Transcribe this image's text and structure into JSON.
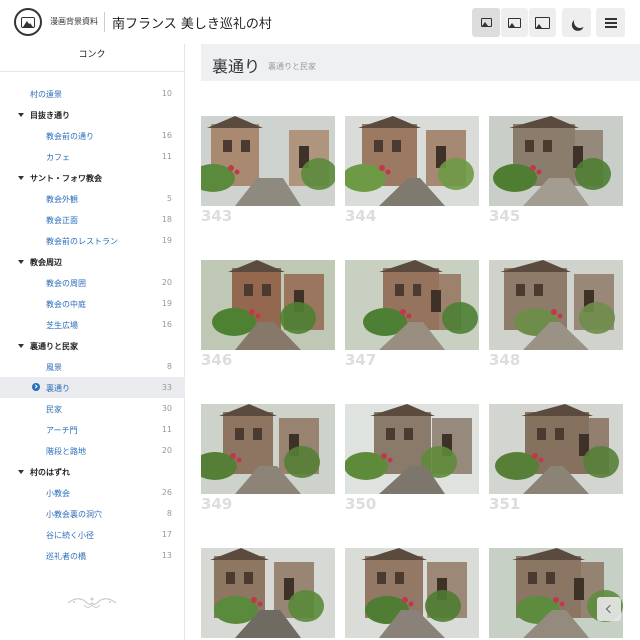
{
  "header": {
    "site_name": "漫画背景資料",
    "page_title": "南フランス 美しき巡礼の村",
    "buttons": [
      {
        "icon": "image-small-icon",
        "active": true
      },
      {
        "icon": "image-medium-icon",
        "active": false
      },
      {
        "icon": "image-large-icon",
        "active": false
      },
      {
        "icon": "moon-icon",
        "active": false
      },
      {
        "icon": "menu-icon",
        "active": false
      }
    ]
  },
  "sidebar": {
    "title": "コンク",
    "rows": [
      {
        "kind": "top",
        "label": "村の遠景",
        "count": "10"
      },
      {
        "kind": "group",
        "label": "目抜き通り"
      },
      {
        "kind": "child",
        "label": "教会前の通り",
        "count": "16"
      },
      {
        "kind": "child",
        "label": "カフェ",
        "count": "11"
      },
      {
        "kind": "group",
        "label": "サント・フォワ教会"
      },
      {
        "kind": "child",
        "label": "教会外観",
        "count": "5"
      },
      {
        "kind": "child",
        "label": "教会正面",
        "count": "18"
      },
      {
        "kind": "child",
        "label": "教会前のレストラン",
        "count": "19"
      },
      {
        "kind": "group",
        "label": "教会周辺"
      },
      {
        "kind": "child",
        "label": "教会の周囲",
        "count": "20"
      },
      {
        "kind": "child",
        "label": "教会の中庭",
        "count": "19"
      },
      {
        "kind": "child",
        "label": "芝生広場",
        "count": "16"
      },
      {
        "kind": "group",
        "label": "裏通りと民家"
      },
      {
        "kind": "child",
        "label": "風景",
        "count": "8"
      },
      {
        "kind": "child",
        "label": "裏通り",
        "count": "33",
        "selected": true
      },
      {
        "kind": "child",
        "label": "民家",
        "count": "30"
      },
      {
        "kind": "child",
        "label": "アーチ門",
        "count": "11"
      },
      {
        "kind": "child",
        "label": "階段と路地",
        "count": "20"
      },
      {
        "kind": "group",
        "label": "村のはずれ"
      },
      {
        "kind": "child",
        "label": "小教会",
        "count": "26"
      },
      {
        "kind": "child",
        "label": "小教会裏の洞穴",
        "count": "8"
      },
      {
        "kind": "child",
        "label": "谷に続く小径",
        "count": "17"
      },
      {
        "kind": "child",
        "label": "巡礼者の橋",
        "count": "13"
      }
    ]
  },
  "main": {
    "title": "裏通り",
    "subtitle": "裏通りと民家",
    "photos": [
      {
        "number": "343",
        "sky": "#cfd3cf",
        "wall": "#a98a70",
        "ground": "#8f8a80",
        "green": "#5c8a3c"
      },
      {
        "number": "344",
        "sky": "#d9dcd8",
        "wall": "#9c7a62",
        "ground": "#7e7a70",
        "green": "#6e9a46"
      },
      {
        "number": "345",
        "sky": "#c9cec8",
        "wall": "#8b7d6c",
        "ground": "#a39c90",
        "green": "#4f7e33"
      },
      {
        "number": "346",
        "sky": "#bfc8b4",
        "wall": "#94674f",
        "ground": "#86796a",
        "green": "#4e8132"
      },
      {
        "number": "347",
        "sky": "#c8d0c2",
        "wall": "#96735d",
        "ground": "#9a8e80",
        "green": "#4d8034"
      },
      {
        "number": "348",
        "sky": "#d0d2cc",
        "wall": "#8f7b69",
        "ground": "#9b9286",
        "green": "#6f8d4a"
      },
      {
        "number": "349",
        "sky": "#cdd2cb",
        "wall": "#8e7562",
        "ground": "#8d8478",
        "green": "#557f36"
      },
      {
        "number": "350",
        "sky": "#dfe3e0",
        "wall": "#8a7a6a",
        "ground": "#7d766c",
        "green": "#5e8b3a"
      },
      {
        "number": "351",
        "sky": "#d3d6d0",
        "wall": "#86705e",
        "ground": "#8c8377",
        "green": "#577f38"
      },
      {
        "number": "",
        "sky": "#d6d9d4",
        "wall": "#8d7662",
        "ground": "#6f6a62",
        "green": "#5a8a3b"
      },
      {
        "number": "",
        "sky": "#dadcd8",
        "wall": "#927865",
        "ground": "#8a8278",
        "green": "#4f7d33"
      },
      {
        "number": "",
        "sky": "#c6d0c4",
        "wall": "#8b7663",
        "ground": "#948b7e",
        "green": "#5d8c3f"
      }
    ]
  }
}
